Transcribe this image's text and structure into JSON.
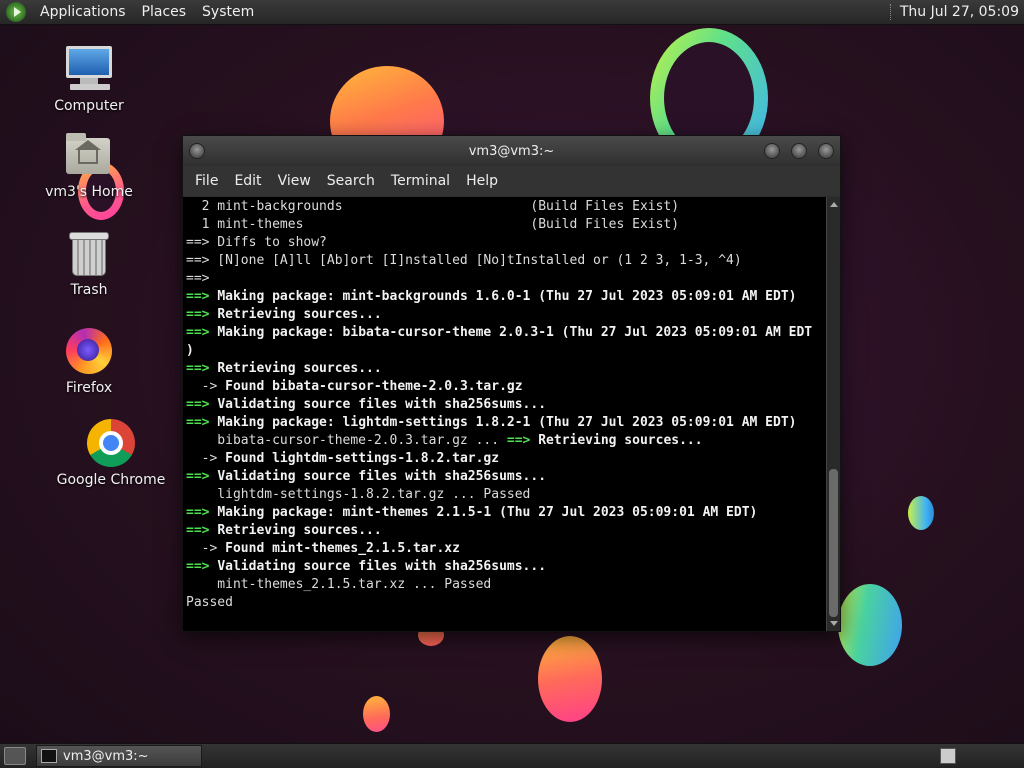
{
  "top_panel": {
    "menus": [
      "Applications",
      "Places",
      "System"
    ],
    "clock": "Thu Jul 27, 05:09"
  },
  "desktop_icons": [
    {
      "label": "Computer",
      "icon": "computer-icon"
    },
    {
      "label": "vm3's Home",
      "icon": "home-folder-icon"
    },
    {
      "label": "Trash",
      "icon": "trash-icon"
    },
    {
      "label": "Firefox",
      "icon": "firefox-icon"
    },
    {
      "label": "Google Chrome",
      "icon": "chrome-icon"
    }
  ],
  "terminal": {
    "title": "vm3@vm3:~",
    "menu": [
      "File",
      "Edit",
      "View",
      "Search",
      "Terminal",
      "Help"
    ],
    "lines": [
      [
        {
          "t": "  2 mint-backgrounds                        (Build Files Exist)",
          "s": ""
        }
      ],
      [
        {
          "t": "  1 mint-themes                             (Build Files Exist)",
          "s": ""
        }
      ],
      [
        {
          "t": "==> Diffs to show?",
          "s": ""
        }
      ],
      [
        {
          "t": "==> [N]one [A]ll [Ab]ort [I]nstalled [No]tInstalled or (1 2 3, 1-3, ^4)",
          "s": ""
        }
      ],
      [
        {
          "t": "==>",
          "s": ""
        }
      ],
      [
        {
          "t": "==> ",
          "s": "g"
        },
        {
          "t": "Making package: mint-backgrounds 1.6.0-1 (Thu 27 Jul 2023 05:09:01 AM EDT)",
          "s": "b"
        }
      ],
      [
        {
          "t": "==> ",
          "s": "g"
        },
        {
          "t": "Retrieving sources...",
          "s": "b"
        }
      ],
      [
        {
          "t": "==> ",
          "s": "g"
        },
        {
          "t": "Making package: bibata-cursor-theme 2.0.3-1 (Thu 27 Jul 2023 05:09:01 AM EDT",
          "s": "b"
        }
      ],
      [
        {
          "t": ")",
          "s": "b"
        }
      ],
      [
        {
          "t": "==> ",
          "s": "g"
        },
        {
          "t": "Retrieving sources...",
          "s": "b"
        }
      ],
      [
        {
          "t": "  -> ",
          "s": ""
        },
        {
          "t": "Found bibata-cursor-theme-2.0.3.tar.gz",
          "s": "b"
        }
      ],
      [
        {
          "t": "==> ",
          "s": "g"
        },
        {
          "t": "Validating source files with sha256sums...",
          "s": "b"
        }
      ],
      [
        {
          "t": "==> ",
          "s": "g"
        },
        {
          "t": "Making package: lightdm-settings 1.8.2-1 (Thu 27 Jul 2023 05:09:01 AM EDT)",
          "s": "b"
        }
      ],
      [
        {
          "t": "    bibata-cursor-theme-2.0.3.tar.gz ... ",
          "s": ""
        },
        {
          "t": "==> ",
          "s": "g"
        },
        {
          "t": "Retrieving sources...",
          "s": "b"
        }
      ],
      [
        {
          "t": "  -> ",
          "s": ""
        },
        {
          "t": "Found lightdm-settings-1.8.2.tar.gz",
          "s": "b"
        }
      ],
      [
        {
          "t": "==> ",
          "s": "g"
        },
        {
          "t": "Validating source files with sha256sums...",
          "s": "b"
        }
      ],
      [
        {
          "t": "    lightdm-settings-1.8.2.tar.gz ... Passed",
          "s": ""
        }
      ],
      [
        {
          "t": "==> ",
          "s": "g"
        },
        {
          "t": "Making package: mint-themes 2.1.5-1 (Thu 27 Jul 2023 05:09:01 AM EDT)",
          "s": "b"
        }
      ],
      [
        {
          "t": "==> ",
          "s": "g"
        },
        {
          "t": "Retrieving sources...",
          "s": "b"
        }
      ],
      [
        {
          "t": "  -> ",
          "s": ""
        },
        {
          "t": "Found mint-themes_2.1.5.tar.xz",
          "s": "b"
        }
      ],
      [
        {
          "t": "==> ",
          "s": "g"
        },
        {
          "t": "Validating source files with sha256sums...",
          "s": "b"
        }
      ],
      [
        {
          "t": "    mint-themes_2.1.5.tar.xz ... Passed",
          "s": ""
        }
      ],
      [
        {
          "t": "Passed",
          "s": ""
        }
      ]
    ]
  },
  "bottom_panel": {
    "task_label": "vm3@vm3:~"
  },
  "colors": {
    "prompt_green": "#4ee04e",
    "terminal_bg": "#000000",
    "panel_bg": "#2e2e2e"
  }
}
